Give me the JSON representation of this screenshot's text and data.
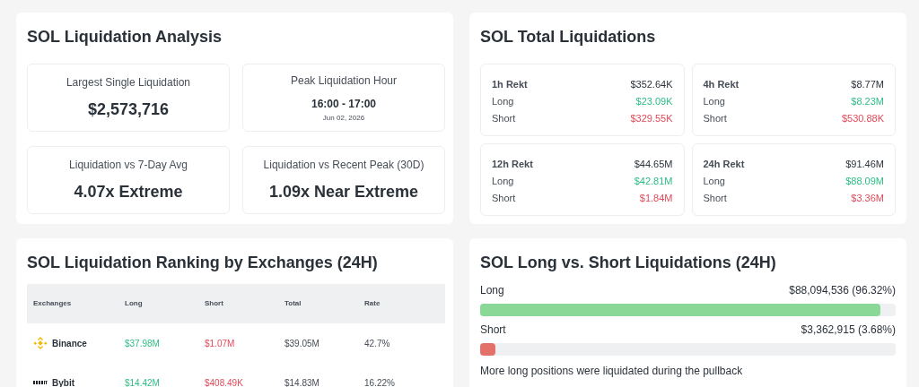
{
  "analysis": {
    "title": "SOL Liquidation Analysis",
    "cards": [
      {
        "kind": "stat",
        "label": "Largest Single Liquidation",
        "value": "$2,573,716"
      },
      {
        "kind": "time",
        "label": "Peak Liquidation Hour",
        "value": "16:00 - 17:00",
        "date": "Jun 02, 2026"
      },
      {
        "kind": "stat",
        "label": "Liquidation vs 7-Day Avg",
        "value": "4.07x Extreme"
      },
      {
        "kind": "stat",
        "label": "Liquidation vs Recent Peak (30D)",
        "value": "1.09x Near Extreme"
      }
    ]
  },
  "totals": {
    "title": "SOL Total Liquidations",
    "cards": [
      {
        "label": "1h Rekt",
        "total": "$352.64K",
        "long_label": "Long",
        "long": "$23.09K",
        "short_label": "Short",
        "short": "$329.55K"
      },
      {
        "label": "4h Rekt",
        "total": "$8.77M",
        "long_label": "Long",
        "long": "$8.23M",
        "short_label": "Short",
        "short": "$530.88K"
      },
      {
        "label": "12h Rekt",
        "total": "$44.65M",
        "long_label": "Long",
        "long": "$42.81M",
        "short_label": "Short",
        "short": "$1.84M"
      },
      {
        "label": "24h Rekt",
        "total": "$91.46M",
        "long_label": "Long",
        "long": "$88.09M",
        "short_label": "Short",
        "short": "$3.36M"
      }
    ]
  },
  "ranking": {
    "title": "SOL Liquidation Ranking by Exchanges (24H)",
    "columns": [
      "Exchanges",
      "Long",
      "Short",
      "Total",
      "Rate"
    ],
    "rows": [
      {
        "kind": "diamond",
        "exchange": "Binance",
        "long": "$37.98M",
        "short": "$1.07M",
        "total": "$39.05M",
        "rate": "42.7%"
      },
      {
        "kind": "wordmark",
        "exchange": "Bybit",
        "long": "$14.42M",
        "short": "$408.49K",
        "total": "$14.83M",
        "rate": "16.22%"
      }
    ]
  },
  "long_short": {
    "title": "SOL Long vs. Short Liquidations (24H)",
    "bars": [
      {
        "kind": "long",
        "label": "Long",
        "reading": "$88,094,536 (96.32%)",
        "level": 0.9632
      },
      {
        "kind": "short",
        "label": "Short",
        "reading": "$3,362,915 (3.68%)",
        "level": 0.0368
      }
    ],
    "note": "More long positions were liquidated during the pullback"
  }
}
